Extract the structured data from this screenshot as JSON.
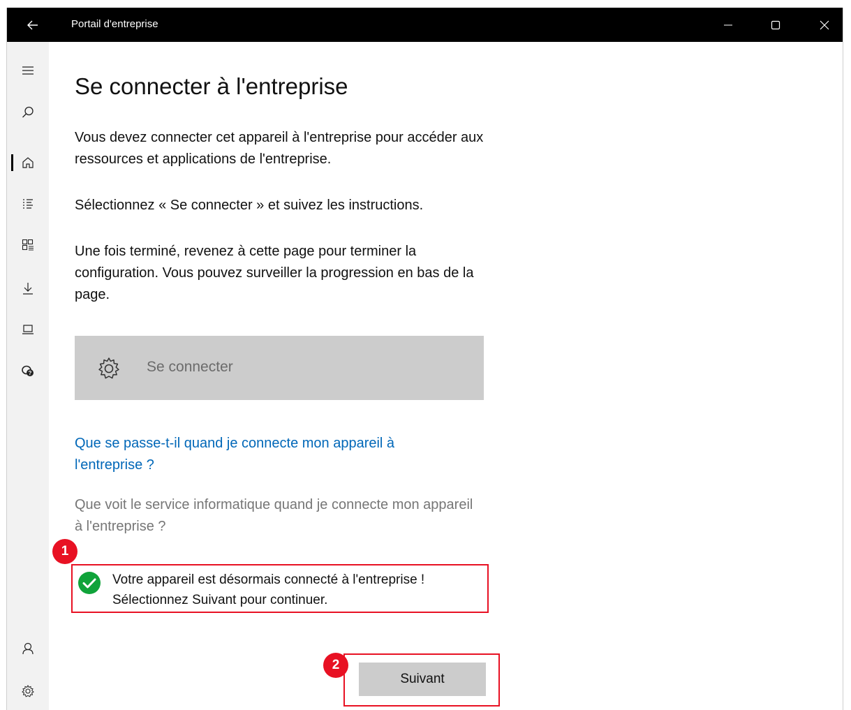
{
  "window": {
    "title": "Portail d'entreprise"
  },
  "page": {
    "title": "Se connecter à l'entreprise",
    "para1": "Vous devez connecter cet appareil à l'entreprise pour accéder aux ressources et applications de l'entreprise.",
    "para2": "Sélectionnez « Se connecter » et suivez les instructions.",
    "para3": "Une fois terminé, revenez à cette page pour terminer la configuration. Vous pouvez surveiller la progression en bas de la page.",
    "connect_button": "Se connecter",
    "link_what_happens": "Que se passe-t-il quand je connecte mon appareil à l'entreprise ?",
    "link_what_it_sees": "Que voit le service informatique quand je connecte mon appareil à l'entreprise ?",
    "status_line1": "Votre appareil est désormais connecté à l'entreprise !",
    "status_line2": "Sélectionnez Suivant pour continuer.",
    "next_button": "Suivant"
  },
  "callouts": {
    "one": "1",
    "two": "2"
  },
  "icons": {
    "nav": [
      "hamburger-icon",
      "search-icon",
      "home-icon",
      "list-icon",
      "apps-icon",
      "download-icon",
      "device-icon",
      "help-icon",
      "account-icon",
      "settings-icon"
    ],
    "success_color": "#10a33a",
    "link_color": "#0067b8",
    "highlight_color": "#e81123"
  }
}
